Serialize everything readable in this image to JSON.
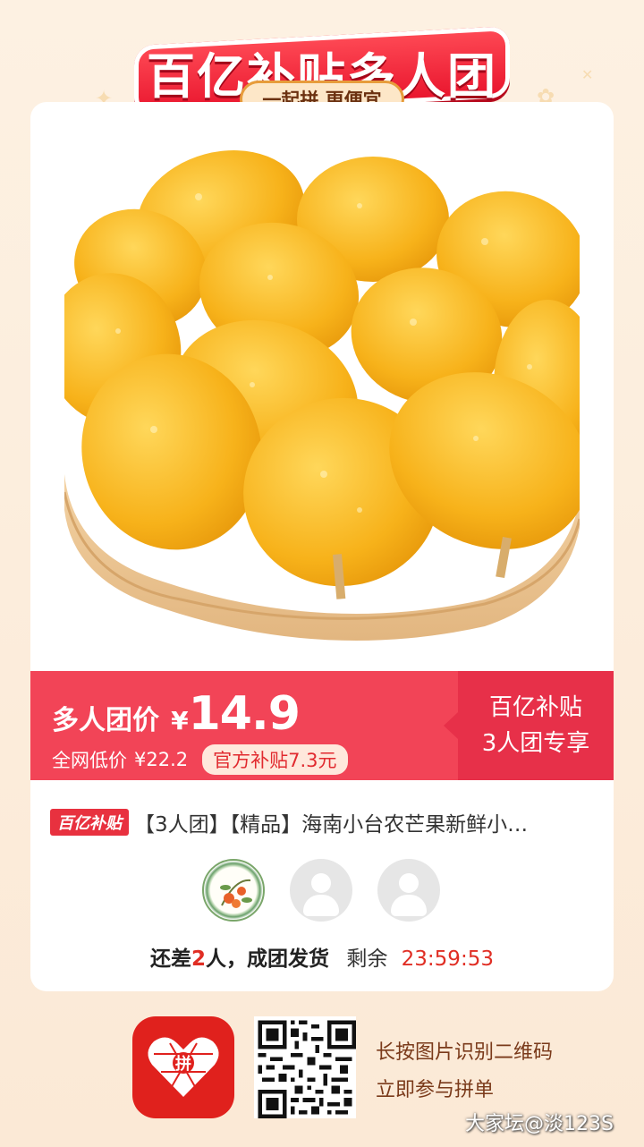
{
  "banner": {
    "title": "百亿补贴多人团",
    "subtitle": "一起拼 更便宜"
  },
  "product": {
    "image_alt": "mangoes",
    "price_label": "多人团价",
    "currency": "¥",
    "price": "14.9",
    "compare_label": "全网低价",
    "compare_price": "¥22.2",
    "subsidy": "官方补贴7.3元",
    "side_line1": "百亿补贴",
    "side_line2": "3人团专享",
    "badge": "百亿补贴",
    "title": "【3人团】【精品】海南小台农芒果新鲜小…"
  },
  "group": {
    "status_prefix": "还差",
    "missing_count": "2",
    "status_suffix": "人，成团发货",
    "remaining_label": "剩余",
    "countdown": "23:59:53"
  },
  "footer": {
    "app_icon_text": "拼",
    "line1": "长按图片识别二维码",
    "line2": "立即参与拼单",
    "watermark": "大家坛@淡123S"
  },
  "colors": {
    "accent": "#f24457",
    "accent_dark": "#e73049",
    "brand_red": "#e0211d"
  }
}
